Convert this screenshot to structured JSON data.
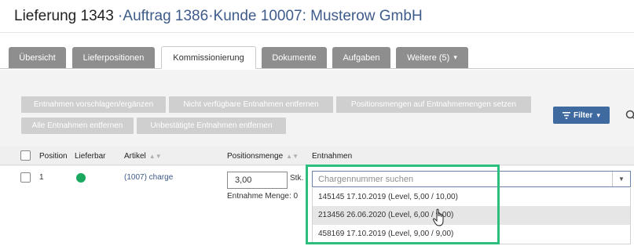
{
  "header": {
    "title": "Lieferung 1343",
    "sep1": " ·",
    "order_link": "Auftrag 1386",
    "sep2": "·",
    "customer_link": "Kunde 10007: Musterow GmbH"
  },
  "tabs": [
    {
      "label": "Übersicht"
    },
    {
      "label": "Lieferpositionen"
    },
    {
      "label": "Kommissionierung"
    },
    {
      "label": "Dokumente"
    },
    {
      "label": "Aufgaben"
    },
    {
      "label": "Weitere (5)"
    }
  ],
  "toolbar": {
    "suggest": "Entnahmen vorschlagen/ergänzen",
    "remove_unavailable": "Nicht verfügbare Entnahmen entfernen",
    "set_quantities": "Positionsmengen auf Entnahmemengen setzen",
    "remove_all": "Alle Entnahmen entfernen",
    "remove_unconfirmed": "Unbestätigte Entnahmen entfernen",
    "filter": "Filter"
  },
  "table": {
    "headers": {
      "position": "Position",
      "lieferbar": "Lieferbar",
      "artikel": "Artikel",
      "positionsmenge": "Positionsmenge",
      "entnahmen": "Entnahmen"
    },
    "row": {
      "position": "1",
      "artikel": "(1007) charge",
      "quantity": "3,00",
      "unit": "Stk.",
      "entnahme_menge": "Entnahme Menge: 0",
      "status_color": "#1aa860"
    }
  },
  "combo": {
    "placeholder": "Chargennummer suchen",
    "options": [
      "145145 17.10.2019 (Level, 5,00 / 10,00)",
      "213456 26.06.2020 (Level, 6,00 / 9,00)",
      "458169 17.10.2019 (Level, 9,00 / 9,00)"
    ]
  },
  "colors": {
    "accent": "#3e6aa0",
    "highlight": "#2bbe7c",
    "tab_inactive": "#8e8e8e"
  }
}
